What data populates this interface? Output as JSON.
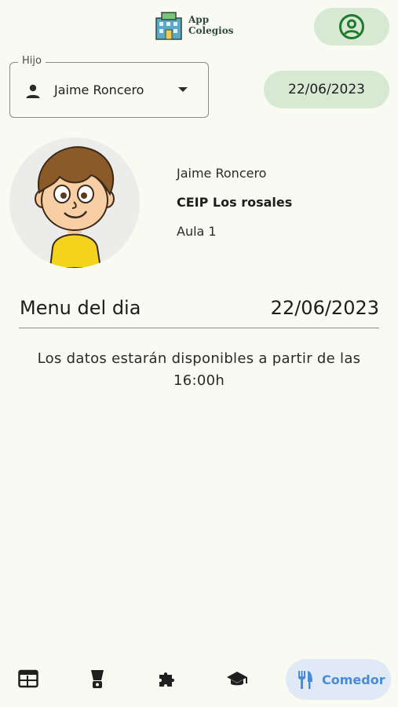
{
  "header": {
    "logo_line1": "App",
    "logo_line2": "Colegios",
    "profile_icon": "account-circle-icon"
  },
  "child_selector": {
    "legend": "Hijo",
    "selected": "Jaime Roncero",
    "icon": "person-icon"
  },
  "date_chip": "22/06/2023",
  "student": {
    "name": "Jaime Roncero",
    "school": "CEIP Los rosales",
    "classroom": "Aula 1"
  },
  "menu": {
    "title": "Menu del dia",
    "date": "22/06/2023",
    "message": "Los datos estarán disponibles a partir de las 16:00h"
  },
  "bottom_nav": {
    "items": [
      {
        "icon": "newspaper-icon",
        "label": ""
      },
      {
        "icon": "blender-icon",
        "label": ""
      },
      {
        "icon": "puzzle-icon",
        "label": ""
      },
      {
        "icon": "school-icon",
        "label": ""
      },
      {
        "icon": "restaurant-icon",
        "label": "Comedor",
        "active": true
      }
    ]
  },
  "colors": {
    "background": "#f9faf1",
    "chip": "#d7e8d3",
    "accent_green": "#2e7d32",
    "nav_active_bg": "#dfeaf6",
    "nav_active_text": "#4a8ad6"
  }
}
